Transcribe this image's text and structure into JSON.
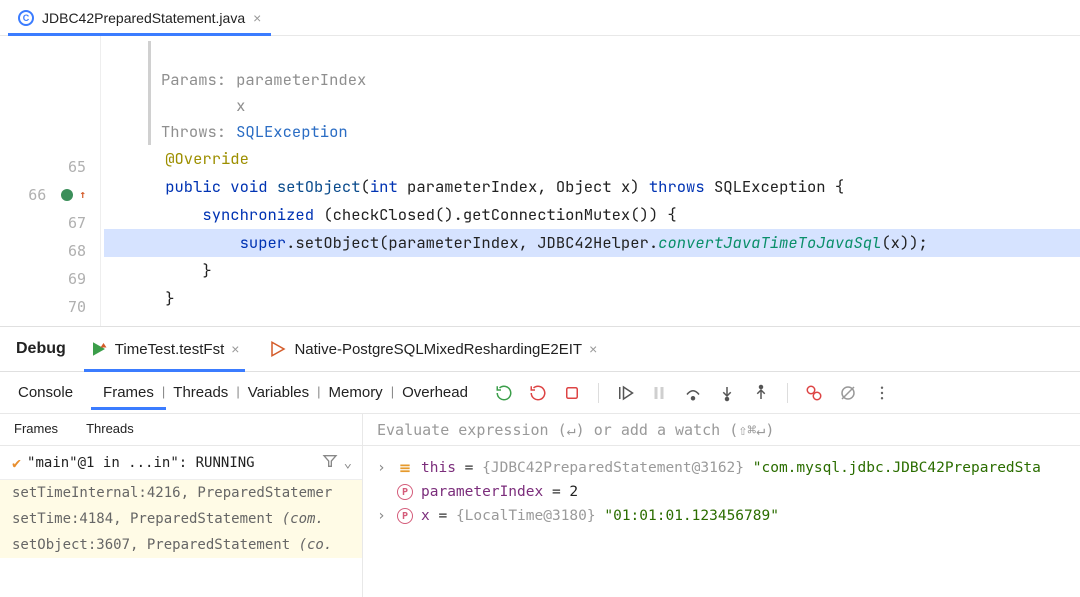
{
  "file_tab": {
    "name": "JDBC42PreparedStatement.java",
    "icon_letter": "C"
  },
  "doc": {
    "params_label": "Params:",
    "params": [
      "parameterIndex",
      "x"
    ],
    "throws_label": "Throws:",
    "throws_value": "SQLException"
  },
  "code_lines": [
    {
      "n": 65,
      "raw": "    @Override",
      "kind": "ann"
    },
    {
      "n": 66,
      "raw_html": "    <span class='token-kw'>public void</span> <span style='color:#0a4b8c'>setObject</span>(<span class='token-kw'>int</span> parameterIndex, Object x) <span class='token-kw'>throws</span> SQLException {",
      "bp": true
    },
    {
      "n": 67,
      "raw_html": "        <span class='token-kw'>synchronized</span> (checkClosed().getConnectionMutex()) {"
    },
    {
      "n": 68,
      "raw_html": "            <span class='token-kw'>super</span>.setObject(parameterIndex, JDBC42Helper.<span class='token-call'>convertJavaTimeToJavaSql</span>(x));",
      "hl": true
    },
    {
      "n": 69,
      "raw": "        }"
    },
    {
      "n": 70,
      "raw": "    }"
    }
  ],
  "debug": {
    "title": "Debug",
    "run_configs": [
      {
        "name": "TimeTest.testFst",
        "active": true
      },
      {
        "name": "Native-PostgreSQLMixedReshardingE2EIT",
        "active": false
      }
    ],
    "toolbar_tabs": [
      "Console",
      "Frames",
      "Threads",
      "Variables",
      "Memory",
      "Overhead"
    ],
    "toolbar_active": "Frames",
    "frames_tabs": [
      "Frames",
      "Threads"
    ],
    "frames_tabs_active": "Frames",
    "thread_label": "\"main\"@1 in ...in\": RUNNING",
    "stack": [
      "setTimeInternal:4216, PreparedStatemer",
      "setTime:4184, PreparedStatement (com.",
      "setObject:3607, PreparedStatement (co."
    ],
    "expr_placeholder": "Evaluate expression (↵) or add a watch (⇧⌘↵)",
    "vars": [
      {
        "expandable": true,
        "icon": "obj",
        "name": "this",
        "obj": "{JDBC42PreparedStatement@3162}",
        "str": "\"com.mysql.jdbc.JDBC42PreparedSta"
      },
      {
        "expandable": false,
        "icon": "p",
        "name": "parameterIndex",
        "plain": "2"
      },
      {
        "expandable": true,
        "icon": "p",
        "name": "x",
        "obj": "{LocalTime@3180}",
        "str": "\"01:01:01.123456789\""
      }
    ]
  }
}
